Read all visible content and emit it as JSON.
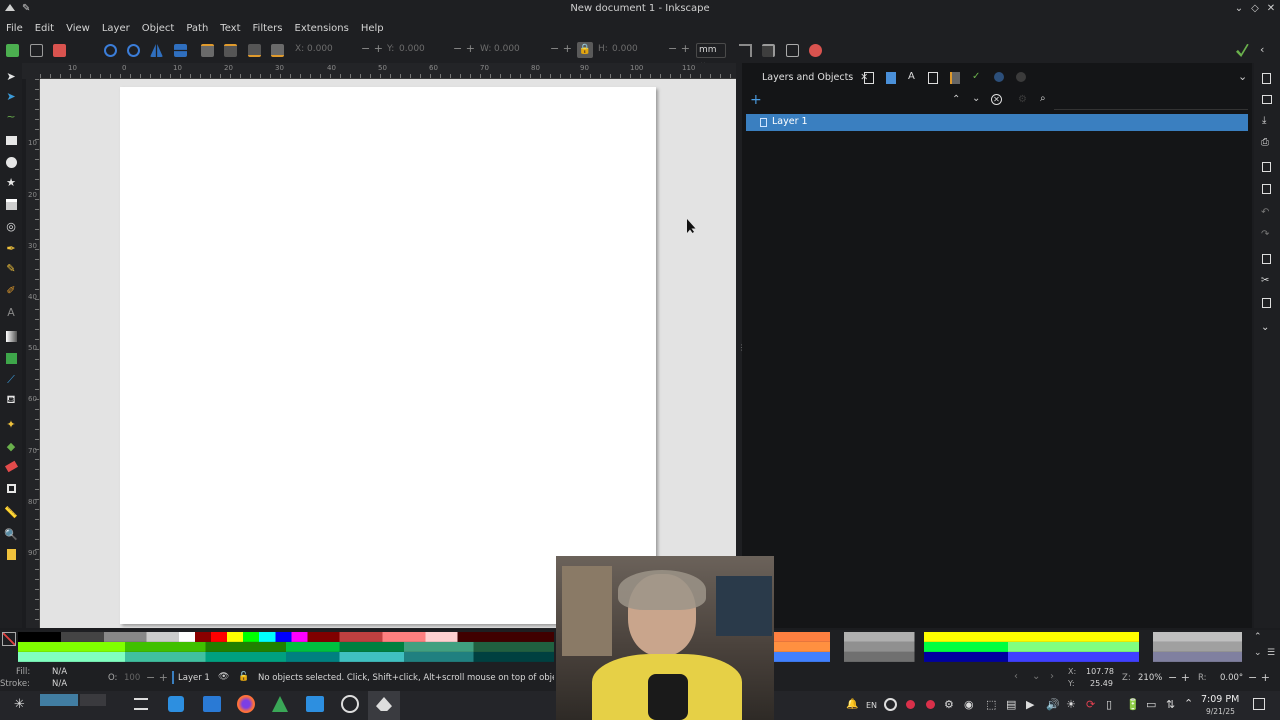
{
  "window": {
    "title": "New document 1 - Inkscape"
  },
  "menu": [
    "File",
    "Edit",
    "View",
    "Layer",
    "Object",
    "Path",
    "Text",
    "Filters",
    "Extensions",
    "Help"
  ],
  "toolbar": {
    "x_label": "X:",
    "x_value": "0.000",
    "y_label": "Y:",
    "y_value": "0.000",
    "w_label": "W:",
    "w_value": "0.000",
    "h_label": "H:",
    "h_value": "0.000",
    "unit": "mm"
  },
  "ruler": {
    "h_ticks": [
      "10",
      "0",
      "10",
      "20",
      "30",
      "40",
      "50",
      "60",
      "70",
      "80",
      "90",
      "100",
      "110"
    ],
    "v_ticks": [
      "10",
      "20",
      "30",
      "40",
      "50",
      "60",
      "70",
      "80",
      "90"
    ]
  },
  "dock": {
    "tab_label": "Layers and Objects",
    "layers": [
      "Layer 1"
    ]
  },
  "statusbar": {
    "fill_label": "Fill:",
    "fill_value": "N/A",
    "stroke_label": "Stroke:",
    "stroke_value": "N/A",
    "opacity_label": "O:",
    "opacity_value": "100",
    "layer": "Layer 1",
    "message": "No objects selected. Click, Shift+click, Alt+scroll mouse on top of objects, o",
    "x_label": "X:",
    "x_value": "107.78",
    "y_label": "Y:",
    "y_value": "25.49",
    "zoom_label": "Z:",
    "zoom_value": "210%",
    "rot_label": "R:",
    "rot_value": "0.00°"
  },
  "taskbar": {
    "lang": "EN",
    "time": "7:09 PM",
    "date": "9/21/25"
  },
  "colors": {
    "accent": "#3a7fc0",
    "dark_bg": "#1e1f22",
    "dock_bg": "#141517",
    "canvas_bg": "#e3e3e3"
  }
}
